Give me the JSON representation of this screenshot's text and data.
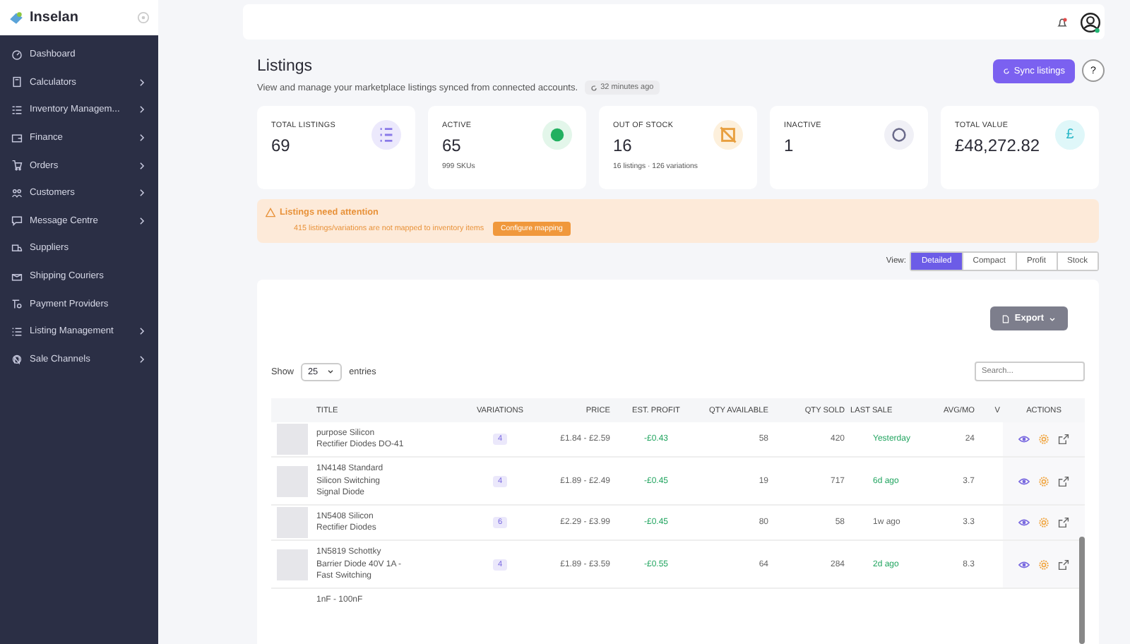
{
  "brand": {
    "name": "Inselan"
  },
  "sidebar": {
    "items": [
      {
        "label": "Dashboard",
        "submenu": false
      },
      {
        "label": "Calculators",
        "submenu": true
      },
      {
        "label": "Inventory Managem...",
        "submenu": true
      },
      {
        "label": "Finance",
        "submenu": true
      },
      {
        "label": "Orders",
        "submenu": true
      },
      {
        "label": "Customers",
        "submenu": true
      },
      {
        "label": "Message Centre",
        "submenu": true
      },
      {
        "label": "Suppliers",
        "submenu": false
      },
      {
        "label": "Shipping Couriers",
        "submenu": false
      },
      {
        "label": "Payment Providers",
        "submenu": false
      },
      {
        "label": "Listing Management",
        "submenu": true
      },
      {
        "label": "Sale Channels",
        "submenu": true
      }
    ]
  },
  "page": {
    "title": "Listings",
    "subtitle": "View and manage your marketplace listings synced from connected accounts.",
    "sync_age": "32 minutes ago",
    "sync_button": "Sync listings",
    "help_button": "?"
  },
  "stats": [
    {
      "kind": "list",
      "label": "TOTAL LISTINGS",
      "value": "69"
    },
    {
      "kind": "active",
      "label": "ACTIVE",
      "value": "65",
      "sub": "999 SKUs"
    },
    {
      "kind": "stock",
      "label": "OUT OF STOCK",
      "value": "16",
      "sub": "16 listings · 126 variations"
    },
    {
      "kind": "inactive",
      "label": "INACTIVE",
      "value": "1"
    },
    {
      "kind": "money",
      "label": "TOTAL VALUE",
      "value": "£48,272.82",
      "symbol": "£"
    }
  ],
  "alert": {
    "title": "Listings need attention",
    "message": "415 listings/variations are not mapped to inventory items",
    "button": "Configure mapping"
  },
  "view": {
    "label": "View:",
    "options": [
      {
        "label": "Detailed",
        "selected": true
      },
      {
        "label": "Compact",
        "selected": false
      },
      {
        "label": "Profit",
        "selected": false
      },
      {
        "label": "Stock",
        "selected": false
      }
    ]
  },
  "table": {
    "export_button": "Export",
    "show_label": "Show",
    "page_size": "25",
    "entries_label": "entries",
    "search_placeholder": "Search...",
    "columns": [
      "TITLE",
      "VARIATIONS",
      "PRICE",
      "EST. PROFIT",
      "QTY AVAILABLE",
      "QTY SOLD",
      "LAST SALE",
      "AVG/MO",
      "V",
      "ACTIONS"
    ],
    "rows": [
      {
        "title": "purpose Silicon Rectifier Diodes DO-41",
        "variations": "4",
        "price": "£1.84 - £2.59",
        "profit": "-£0.43",
        "qty_available": "58",
        "qty_sold": "420",
        "last_sale": "Yesterday",
        "recent": true,
        "avg_mo": "24"
      },
      {
        "title": "1N4148 Standard Silicon Switching Signal Diode",
        "variations": "4",
        "price": "£1.89 - £2.49",
        "profit": "-£0.45",
        "qty_available": "19",
        "qty_sold": "717",
        "last_sale": "6d ago",
        "recent": true,
        "avg_mo": "3.7"
      },
      {
        "title": "1N5408 Silicon Rectifier Diodes",
        "variations": "6",
        "price": "£2.29 - £3.99",
        "profit": "-£0.45",
        "qty_available": "80",
        "qty_sold": "58",
        "last_sale": "1w ago",
        "recent": false,
        "avg_mo": "3.3"
      },
      {
        "title": "1N5819 Schottky Barrier Diode 40V 1A - Fast Switching",
        "variations": "4",
        "price": "£1.89 - £3.59",
        "profit": "-£0.55",
        "qty_available": "64",
        "qty_sold": "284",
        "last_sale": "2d ago",
        "recent": true,
        "avg_mo": "8.3"
      }
    ],
    "partial_row": {
      "title": "1nF - 100nF"
    }
  }
}
